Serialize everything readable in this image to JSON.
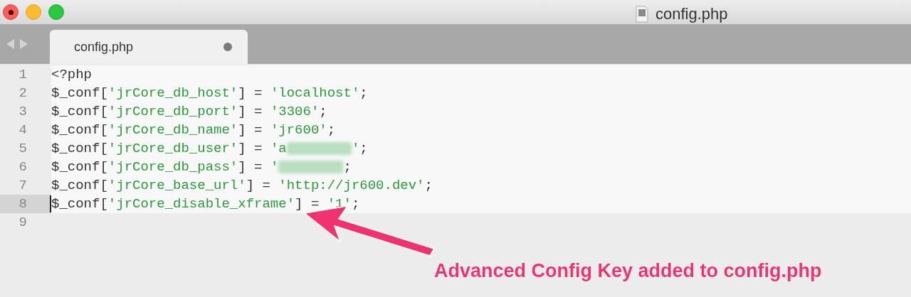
{
  "window": {
    "title": "config.php"
  },
  "tabs": [
    {
      "label": "config.php",
      "selected": true,
      "modified": true
    }
  ],
  "editor": {
    "lines": [
      {
        "number": "1",
        "selected": true,
        "current": false,
        "tokens": [
          {
            "kind": "plain",
            "text": "<?php"
          }
        ]
      },
      {
        "number": "2",
        "selected": true,
        "current": false,
        "tokens": [
          {
            "kind": "plain",
            "text": "$_conf["
          },
          {
            "kind": "string",
            "text": "'jrCore_db_host'"
          },
          {
            "kind": "plain",
            "text": "] = "
          },
          {
            "kind": "string",
            "text": "'localhost'"
          },
          {
            "kind": "plain",
            "text": ";"
          }
        ]
      },
      {
        "number": "3",
        "selected": true,
        "current": false,
        "tokens": [
          {
            "kind": "plain",
            "text": "$_conf["
          },
          {
            "kind": "string",
            "text": "'jrCore_db_port'"
          },
          {
            "kind": "plain",
            "text": "] = "
          },
          {
            "kind": "string",
            "text": "'3306'"
          },
          {
            "kind": "plain",
            "text": ";"
          }
        ]
      },
      {
        "number": "4",
        "selected": true,
        "current": false,
        "tokens": [
          {
            "kind": "plain",
            "text": "$_conf["
          },
          {
            "kind": "string",
            "text": "'jrCore_db_name'"
          },
          {
            "kind": "plain",
            "text": "] = "
          },
          {
            "kind": "string",
            "text": "'jr600'"
          },
          {
            "kind": "plain",
            "text": ";"
          }
        ]
      },
      {
        "number": "5",
        "selected": true,
        "current": false,
        "tokens": [
          {
            "kind": "plain",
            "text": "$_conf["
          },
          {
            "kind": "string",
            "text": "'jrCore_db_user'"
          },
          {
            "kind": "plain",
            "text": "] = "
          },
          {
            "kind": "string",
            "text": "'a"
          },
          {
            "kind": "redacted"
          },
          {
            "kind": "string",
            "text": "'"
          },
          {
            "kind": "plain",
            "text": ";"
          }
        ]
      },
      {
        "number": "6",
        "selected": true,
        "current": false,
        "tokens": [
          {
            "kind": "plain",
            "text": "$_conf["
          },
          {
            "kind": "string",
            "text": "'jrCore_db_pass'"
          },
          {
            "kind": "plain",
            "text": "] = "
          },
          {
            "kind": "string",
            "text": "'"
          },
          {
            "kind": "redacted"
          },
          {
            "kind": "plain",
            "text": ";"
          }
        ]
      },
      {
        "number": "7",
        "selected": true,
        "current": false,
        "tokens": [
          {
            "kind": "plain",
            "text": "$_conf["
          },
          {
            "kind": "string",
            "text": "'jrCore_base_url'"
          },
          {
            "kind": "plain",
            "text": "] = "
          },
          {
            "kind": "string",
            "text": "'http://jr600.dev'"
          },
          {
            "kind": "plain",
            "text": ";"
          }
        ]
      },
      {
        "number": "8",
        "selected": true,
        "current": true,
        "tokens": [
          {
            "kind": "plain",
            "text": "$_conf["
          },
          {
            "kind": "string",
            "text": "'jrCore_disable_xframe'"
          },
          {
            "kind": "plain",
            "text": "] = "
          },
          {
            "kind": "string",
            "text": "'1'"
          },
          {
            "kind": "plain",
            "text": ";"
          }
        ]
      },
      {
        "number": "9",
        "selected": false,
        "current": false
      }
    ]
  },
  "annotation": {
    "text": "Advanced Config Key added to config.php"
  }
}
